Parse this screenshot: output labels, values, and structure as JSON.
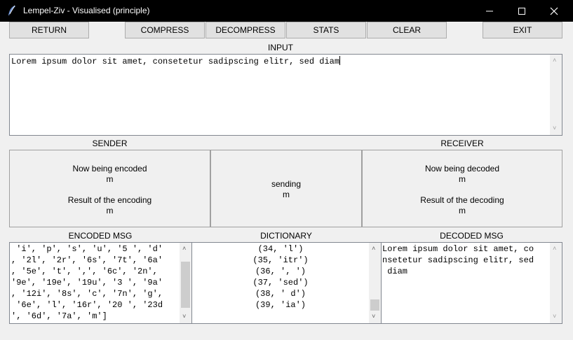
{
  "window": {
    "title": "Lempel-Ziv - Visualised (principle)"
  },
  "toolbar": {
    "return_label": "RETURN",
    "compress_label": "COMPRESS",
    "decompress_label": "DECOMPRESS",
    "stats_label": "STATS",
    "clear_label": "CLEAR",
    "exit_label": "EXIT"
  },
  "input": {
    "label": "INPUT",
    "value": "Lorem ipsum dolor sit amet, consetetur sadipscing elitr, sed diam"
  },
  "sender": {
    "label": "SENDER",
    "encoding_heading": "Now being encoded",
    "encoding_value": "m",
    "result_heading": "Result of the encoding",
    "result_value": "m"
  },
  "channel": {
    "status": "sending",
    "value": "m"
  },
  "receiver": {
    "label": "RECEIVER",
    "decoding_heading": "Now being decoded",
    "decoding_value": "m",
    "result_heading": "Result of the decoding",
    "result_value": "m"
  },
  "encoded": {
    "label": "ENCODED MSG",
    "lines": [
      " 'i', 'p', 's', 'u', '5 ', 'd'",
      ", '2l', '2r', '6s', '7t', '6a'",
      ", '5e', 't', ',', '6c', '2n',",
      "'9e', '19e', '19u', '3 ', '9a'",
      ", '12i', '8s', 'c', '7n', 'g',",
      " '6e', 'l', '16r', '20 ', '23d",
      "', '6d', '7a', 'm']"
    ]
  },
  "dictionary": {
    "label": "DICTIONARY",
    "lines": [
      "(34, 'l')",
      "(35, 'itr')",
      "(36, ', ')",
      "(37, 'sed')",
      "(38, ' d')",
      "(39, 'ia')"
    ]
  },
  "decoded": {
    "label": "DECODED MSG",
    "lines": [
      "Lorem ipsum dolor sit amet, co",
      "nsetetur sadipscing elitr, sed",
      " diam"
    ]
  }
}
